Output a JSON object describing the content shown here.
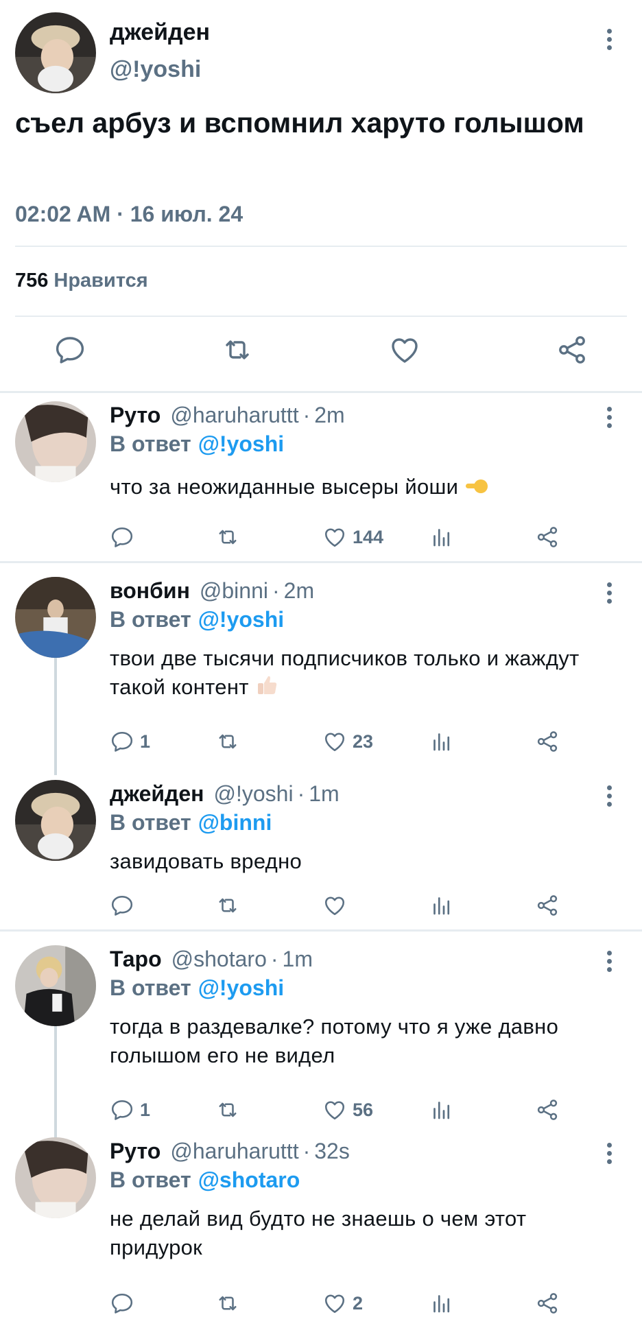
{
  "main_tweet": {
    "author_name": "джейден",
    "author_handle": "@!yoshi",
    "text": "съел арбуз и вспомнил харуто голышом",
    "timestamp": "02:02 AM · 16 июл. 24",
    "likes_count": "756",
    "likes_label": "Нравится",
    "actions": [
      "reply",
      "retweet",
      "like",
      "share"
    ]
  },
  "in_reply_label": "В ответ",
  "replies": [
    {
      "name": "Руто",
      "handle": "@haruharuttt",
      "dot": "·",
      "time": "2m",
      "reply_to": "@!yoshi",
      "text": "что за неожиданные высеры йоши",
      "emoji": "pointing-hand",
      "reply_count": "",
      "like_count": "144"
    },
    {
      "name": "вонбин",
      "handle": "@binni",
      "dot": "·",
      "time": "2m",
      "reply_to": "@!yoshi",
      "text": "твои две тысячи подписчиков только и жаждут такой контент",
      "emoji": "thumbs-up",
      "reply_count": "1",
      "like_count": "23"
    },
    {
      "name": "джейден",
      "handle": "@!yoshi",
      "dot": "·",
      "time": "1m",
      "reply_to": "@binni",
      "text": "завидовать вредно",
      "reply_count": "",
      "like_count": ""
    },
    {
      "name": "Таро",
      "handle": "@shotaro",
      "dot": "·",
      "time": "1m",
      "reply_to": "@!yoshi",
      "text": "тогда в раздевалке? потому что я уже давно голышом его не видел",
      "reply_count": "1",
      "like_count": "56"
    },
    {
      "name": "Руто",
      "handle": "@haruharuttt",
      "dot": "·",
      "time": "32s",
      "reply_to": "@shotaro",
      "text": "не делай вид будто не знаешь о чем этот придурок",
      "reply_count": "",
      "like_count": "2"
    }
  ],
  "colors": {
    "text": "#0f1419",
    "secondary": "#5b7083",
    "accent": "#1d9bf0",
    "divider": "#e6ecf0"
  },
  "icons": [
    "reply-icon",
    "retweet-icon",
    "like-icon",
    "share-icon",
    "analytics-icon",
    "more-icon"
  ]
}
